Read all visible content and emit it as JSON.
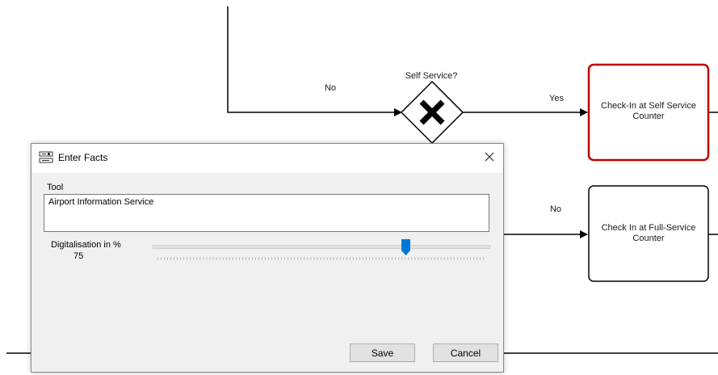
{
  "diagram": {
    "gateway_label": "Self Service?",
    "flow_no_top": "No",
    "flow_yes": "Yes",
    "flow_no_bottom": "No",
    "task_self_service": "Check-In at Self Service Counter",
    "task_full_service": "Check In at Full-Service Counter",
    "selected_border_color": "#c00000"
  },
  "dialog": {
    "title": "Enter Facts",
    "tool_label": "Tool",
    "tool_value": "Airport Information Service",
    "slider_label": "Digitalisation in %",
    "slider_value": "75",
    "slider_fraction": 0.75,
    "save_label": "Save",
    "cancel_label": "Cancel",
    "accent_color": "#0078d7",
    "icons": [
      "facts-icon",
      "close-icon"
    ]
  }
}
